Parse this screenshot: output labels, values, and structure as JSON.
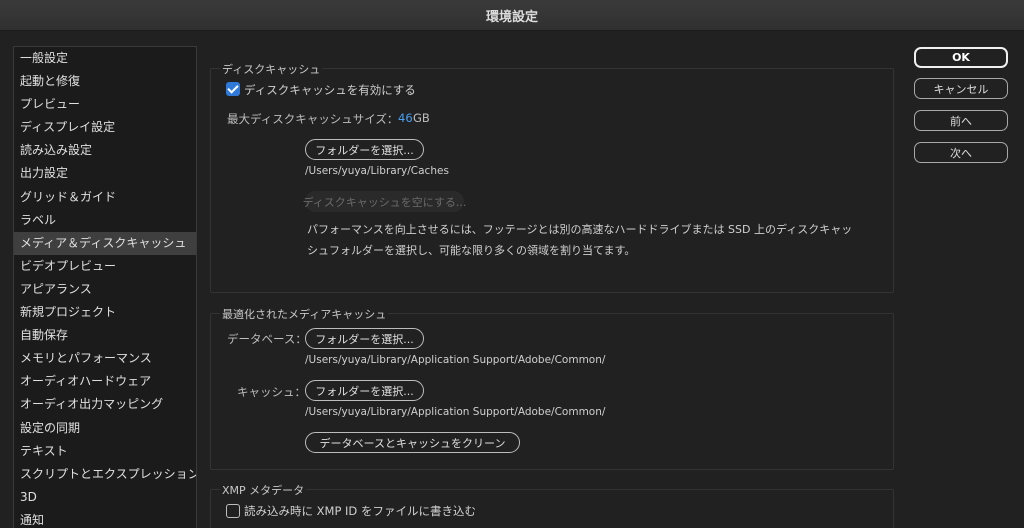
{
  "window": {
    "title": "環境設定"
  },
  "sidebar": {
    "items": [
      "一般設定",
      "起動と修復",
      "プレビュー",
      "ディスプレイ設定",
      "読み込み設定",
      "出力設定",
      "グリッド＆ガイド",
      "ラベル",
      "メディア＆ディスクキャッシュ",
      "ビデオプレビュー",
      "アピアランス",
      "新規プロジェクト",
      "自動保存",
      "メモリとパフォーマンス",
      "オーディオハードウェア",
      "オーディオ出力マッピング",
      "設定の同期",
      "テキスト",
      "スクリプトとエクスプレッション",
      "3D",
      "通知"
    ],
    "selected_index": 8
  },
  "disk_cache": {
    "title": "ディスクキャッシュ",
    "enable_label": "ディスクキャッシュを有効にする",
    "enabled": true,
    "max_size_label": "最大ディスクキャッシュサイズ：",
    "max_size_value": "46",
    "max_size_unit": "GB",
    "choose_folder_label": "フォルダーを選択...",
    "folder_path": "/Users/yuya/Library/Caches",
    "empty_cache_label": "ディスクキャッシュを空にする...",
    "description_line1": "パフォーマンスを向上させるには、フッテージとは別の高速なハードドライブまたは SSD 上のディスクキャッ",
    "description_line2": "シュフォルダーを選択し、可能な限り多くの領域を割り当てます。"
  },
  "media_cache": {
    "title": "最適化されたメディアキャッシュ",
    "database_label": "データベース：",
    "database_button": "フォルダーを選択...",
    "database_path": "/Users/yuya/Library/Application Support/Adobe/Common/",
    "cache_label": "キャッシュ：",
    "cache_button": "フォルダーを選択...",
    "cache_path": "/Users/yuya/Library/Application Support/Adobe/Common/",
    "clean_button": "データベースとキャッシュをクリーン"
  },
  "xmp": {
    "title": "XMP メタデータ",
    "write_id_label": "読み込み時に XMP ID をファイルに書き込む",
    "write_id_checked": false
  },
  "buttons": {
    "ok": "OK",
    "cancel": "キャンセル",
    "previous": "前へ",
    "next": "次へ"
  },
  "colors": {
    "accent": "#2f7ad8",
    "value_blue": "#4a9ff0",
    "background": "#212121"
  }
}
